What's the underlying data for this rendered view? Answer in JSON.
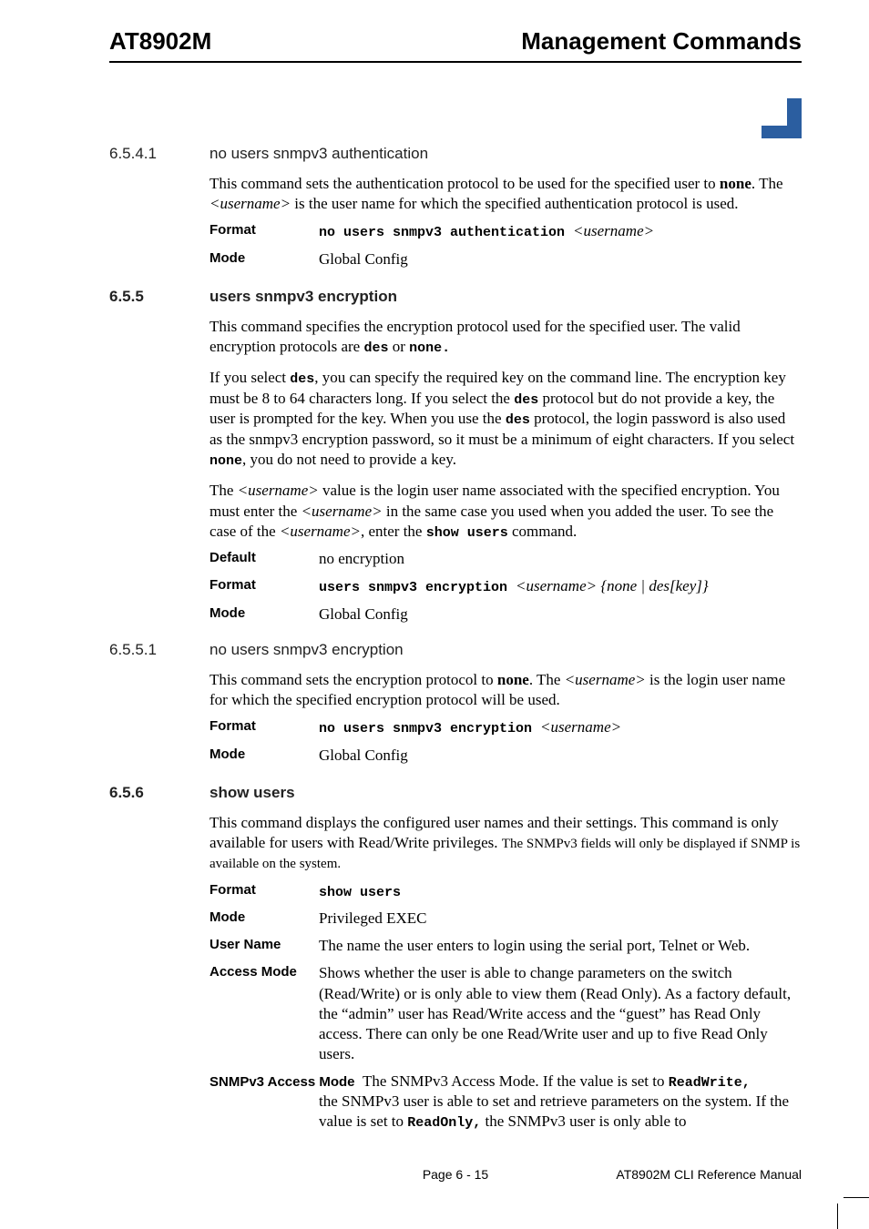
{
  "header": {
    "left": "AT8902M",
    "right": "Management Commands"
  },
  "sec6541": {
    "num": "6.5.4.1",
    "title": "no users snmpv3 authentication",
    "para": "This command sets the authentication protocol to be used for the specified user to ",
    "para_b1": "none",
    "para_2": ". The ",
    "para_i1": "<username>",
    "para_3": " is the user name for which the specified authentication protocol is used.",
    "format_label": "Format",
    "format_cmd": "no users snmpv3 authentication ",
    "format_arg": "<username>",
    "mode_label": "Mode",
    "mode_value": "Global Config"
  },
  "sec655": {
    "num": "6.5.5",
    "title": "users snmpv3 encryption",
    "p1a": "This command specifies the encryption protocol used for the specified user. The valid encryption protocols are ",
    "p1m1": "des",
    "p1b": " or ",
    "p1m2": "none.",
    "p2a": "If you select ",
    "p2m1": "des",
    "p2b": ", you can specify the required key on the command line. The encryption key  must be 8 to 64 characters long. If you select the ",
    "p2m2": "des",
    "p2c": " protocol but do not provide a key, the user is prompted for the key. When you use the ",
    "p2m3": "des",
    "p2d": " protocol, the login password is also used as the snmpv3 encryption password, so it must be a minimum of eight characters. If you select ",
    "p2m4": "none",
    "p2e": ", you do not need to provide a key.",
    "p3a": "The ",
    "p3i1": "<username>",
    "p3b": " value is the login user name associated with the specified encryption. You must enter the ",
    "p3i2": "<username>",
    "p3c": " in the same case you used when you added the user. To see the case of the ",
    "p3i3": "<username>",
    "p3d": ", enter the ",
    "p3m1": "show users",
    "p3e": " command.",
    "default_label": "Default",
    "default_value": "no encryption",
    "format_label": "Format",
    "format_cmd": "users snmpv3 encryption ",
    "format_arg": "<username> {none | des[key]}",
    "mode_label": "Mode",
    "mode_value": "Global Config"
  },
  "sec6551": {
    "num": "6.5.5.1",
    "title": "no users snmpv3 encryption",
    "p1a": "This command sets the encryption protocol to ",
    "p1b1": "none",
    "p1b": ". The ",
    "p1i1": "<username>",
    "p1c": " is the login user name for which the specified encryption protocol will be used.",
    "format_label": "Format",
    "format_cmd": "no users snmpv3 encryption ",
    "format_arg": "<username>",
    "mode_label": "Mode",
    "mode_value": "Global Config"
  },
  "sec656": {
    "num": "6.5.6",
    "title": "show users",
    "p1a": "This command displays the configured user names and their settings. This command is only available for users with Read/Write privileges. ",
    "p1small": "The SNMPv3 fields will only be displayed if SNMP is available on the system.",
    "format_label": "Format",
    "format_cmd": "show users",
    "mode_label": "Mode",
    "mode_value": "Privileged EXEC",
    "username_label": "User Name",
    "username_value": "The name the user enters to login using the serial port, Telnet or Web.",
    "access_label": "Access Mode",
    "access_value": "Shows whether the user is able to change parameters on the switch (Read/Write) or is only able to view them (Read Only). As a factory default, the “admin” user has Read/Write access and the “guest” has Read Only access. There can only be one Read/Write user and up to five Read Only users.",
    "snmp_label": "SNMPv3 Access Mode",
    "snmp_a": "The SNMPv3 Access Mode. If the value is set to ",
    "snmp_m1": "ReadWrite,",
    "snmp_b": " the SNMPv3 user is able to set and retrieve parameters on the system. If the value is set to ",
    "snmp_m2": "ReadOnly,",
    "snmp_c": " the SNMPv3 user is only able to"
  },
  "footer": {
    "page": "Page 6 - 15",
    "manual": "AT8902M CLI Reference Manual"
  }
}
